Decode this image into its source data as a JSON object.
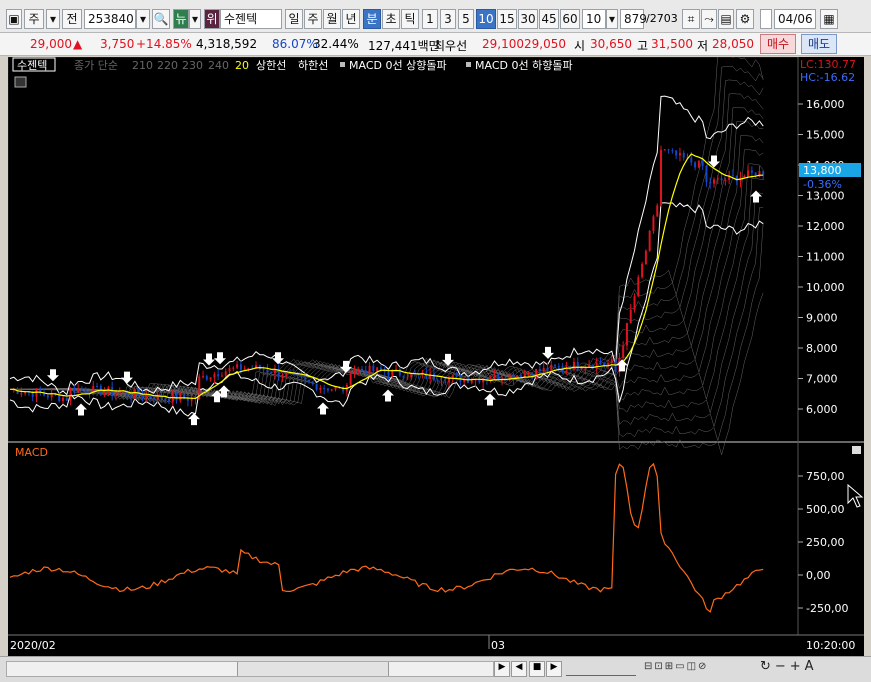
{
  "toolbar": {
    "market": "주",
    "prev_label": "전",
    "code": "253840",
    "news_label": "뉴",
    "rank_label": "위",
    "stock_name": "수젠텍",
    "periods": [
      "일",
      "주",
      "월",
      "년"
    ],
    "unit_labels": [
      "분",
      "초",
      "틱"
    ],
    "intervals": [
      "1",
      "3",
      "5",
      "10",
      "15",
      "30",
      "45",
      "60"
    ],
    "selected_interval": "10",
    "interval_value": "10",
    "count": "879",
    "total": "/2703",
    "date": "04/06"
  },
  "info": {
    "price": "29,000",
    "change": "3,750",
    "change_pct": "+14.85%",
    "volume": "4,318,592",
    "ratio1": "86.07%",
    "ratio2": "32.44%",
    "amount": "127,441백만",
    "bid_label": "최우선",
    "bid1": "29,100",
    "bid2": "29,050",
    "open_label": "시",
    "open": "30,650",
    "high_label": "고",
    "high": "31,500",
    "low_label": "저",
    "low": "28,050",
    "buy_label": "매수",
    "sell_label": "매도"
  },
  "legend": {
    "name": "수젠텍",
    "ma_prefix": "종가 단순",
    "ma_periods": [
      "210",
      "220",
      "230",
      "240",
      "20"
    ],
    "upper": "상한선",
    "lower": "하한선",
    "macd_up": "MACD 0선 상향돌파",
    "macd_down": "MACD 0선 하향돌파"
  },
  "price_panel": {
    "lc": "LC:130.77",
    "hc": "HC:-16.62",
    "current": "13,800",
    "current_pct": "-0.36%",
    "ticks": [
      "16,000",
      "15,000",
      "14,000",
      "13,000",
      "12,000",
      "11,000",
      "10,000",
      "9,000",
      "8,000",
      "7,000",
      "6,000"
    ]
  },
  "macd_panel": {
    "title": "MACD",
    "ticks": [
      "750,00",
      "500,00",
      "250,00",
      "0,00",
      "-250,00"
    ]
  },
  "xaxis": {
    "start": "2020/02",
    "mid": "03",
    "time": "10:20:00"
  },
  "colors": {
    "up": "#e0121f",
    "down": "#1446c8",
    "ma20": "#ffff00",
    "band": "#ffffff",
    "macd": "#ff6a1a"
  }
}
